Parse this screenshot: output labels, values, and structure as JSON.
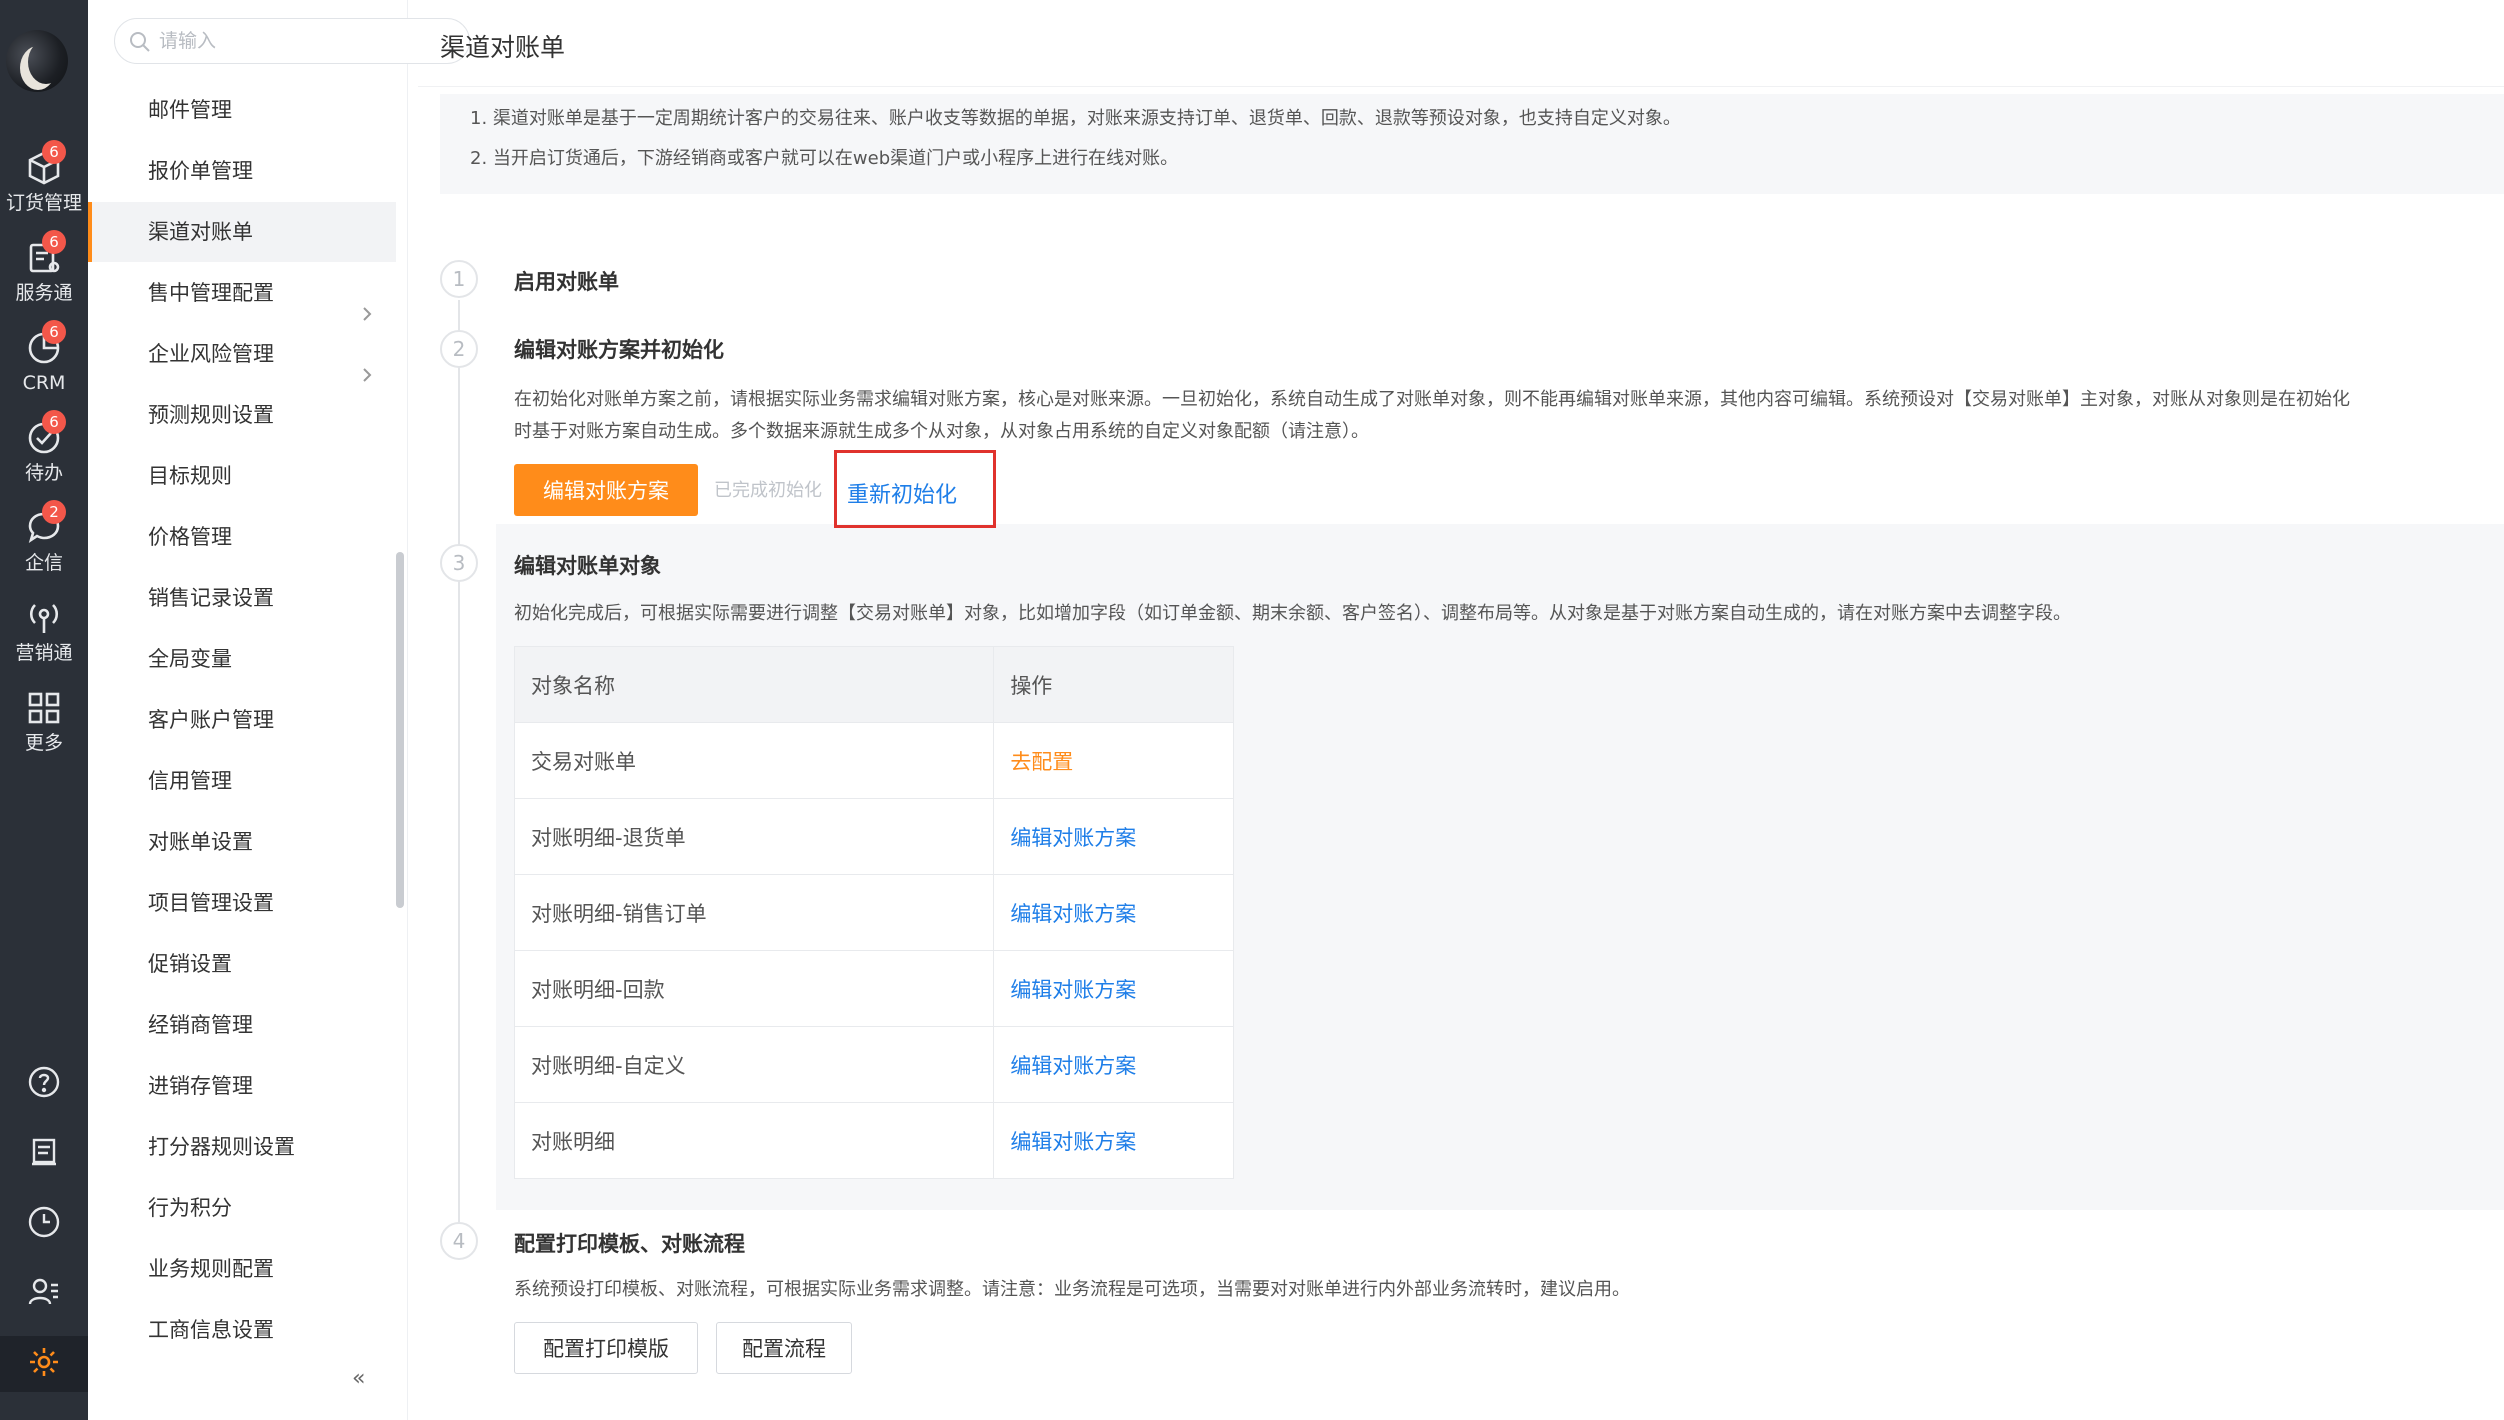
{
  "rail": {
    "items": [
      {
        "label": "订货管理",
        "badge": "6",
        "icon": "cube-icon"
      },
      {
        "label": "服务通",
        "badge": "6",
        "icon": "service-icon"
      },
      {
        "label": "CRM",
        "badge": "6",
        "icon": "pie-chart-icon"
      },
      {
        "label": "待办",
        "badge": "6",
        "icon": "check-circle-icon"
      },
      {
        "label": "企信",
        "badge": "2",
        "icon": "chat-bubble-icon"
      },
      {
        "label": "营销通",
        "badge": "",
        "icon": "broadcast-icon"
      },
      {
        "label": "更多",
        "badge": "",
        "icon": "grid-icon"
      }
    ],
    "bottom_icons": [
      "help-icon",
      "notes-icon",
      "clock-icon",
      "contacts-icon",
      "settings-icon"
    ]
  },
  "menu": {
    "search_placeholder": "请输入",
    "items": [
      {
        "label": "邮件管理"
      },
      {
        "label": "报价单管理"
      },
      {
        "label": "渠道对账单",
        "active": true
      },
      {
        "label": "售中管理配置",
        "expandable": true
      },
      {
        "label": "企业风险管理",
        "expandable": true
      },
      {
        "label": "预测规则设置"
      },
      {
        "label": "目标规则"
      },
      {
        "label": "价格管理"
      },
      {
        "label": "销售记录设置"
      },
      {
        "label": "全局变量"
      },
      {
        "label": "客户账户管理"
      },
      {
        "label": "信用管理"
      },
      {
        "label": "对账单设置"
      },
      {
        "label": "项目管理设置"
      },
      {
        "label": "促销设置"
      },
      {
        "label": "经销商管理"
      },
      {
        "label": "进销存管理"
      },
      {
        "label": "打分器规则设置"
      },
      {
        "label": "行为积分"
      },
      {
        "label": "业务规则配置"
      },
      {
        "label": "工商信息设置"
      }
    ],
    "collapse_glyph": "«"
  },
  "page": {
    "title": "渠道对账单",
    "notice": [
      "1. 渠道对账单是基于一定周期统计客户的交易往来、账户收支等数据的单据，对账来源支持订单、退货单、回款、退款等预设对象，也支持自定义对象。",
      "2. 当开启订货通后，下游经销商或客户就可以在web渠道门户或小程序上进行在线对账。"
    ]
  },
  "steps": [
    {
      "num": "1",
      "title": "启用对账单"
    },
    {
      "num": "2",
      "title": "编辑对账方案并初始化",
      "desc_line1": "在初始化对账单方案之前，请根据实际业务需求编辑对账方案，核心是对账来源。一旦初始化，系统自动生成了对账单对象，则不能再编辑对账单来源，其他内容可编辑。系统预设对【交易对账单】主对象，对账从对象则是在初始化",
      "desc_line2": "时基于对账方案自动生成。多个数据来源就生成多个从对象，从对象占用系统的自定义对象配额（请注意）。",
      "button": "编辑对账方案",
      "status": "已完成初始化",
      "link": "重新初始化"
    },
    {
      "num": "3",
      "title": "编辑对账单对象",
      "desc": "初始化完成后，可根据实际需要进行调整【交易对账单】对象，比如增加字段（如订单金额、期末余额、客户签名）、调整布局等。从对象是基于对账方案自动生成的，请在对账方案中去调整字段。",
      "table": {
        "headers": [
          "对象名称",
          "操作"
        ],
        "rows": [
          {
            "name": "交易对账单",
            "action": "去配置",
            "style": "orange"
          },
          {
            "name": "对账明细-退货单",
            "action": "编辑对账方案",
            "style": "blue"
          },
          {
            "name": "对账明细-销售订单",
            "action": "编辑对账方案",
            "style": "blue"
          },
          {
            "name": "对账明细-回款",
            "action": "编辑对账方案",
            "style": "blue"
          },
          {
            "name": "对账明细-自定义",
            "action": "编辑对账方案",
            "style": "blue"
          },
          {
            "name": "对账明细",
            "action": "编辑对账方案",
            "style": "blue"
          }
        ]
      }
    },
    {
      "num": "4",
      "title": "配置打印模板、对账流程",
      "desc": "系统预设打印模板、对账流程，可根据实际业务需求调整。请注意：业务流程是可选项，当需要对对账单进行内外部业务流转时，建议启用。",
      "buttons": [
        "配置打印模版",
        "配置流程"
      ]
    }
  ],
  "colors": {
    "accent": "#ff8c1a",
    "link": "#1e7ee8",
    "rail": "#2b3038",
    "badge": "#f3574a",
    "highlight": "#e0322d"
  }
}
